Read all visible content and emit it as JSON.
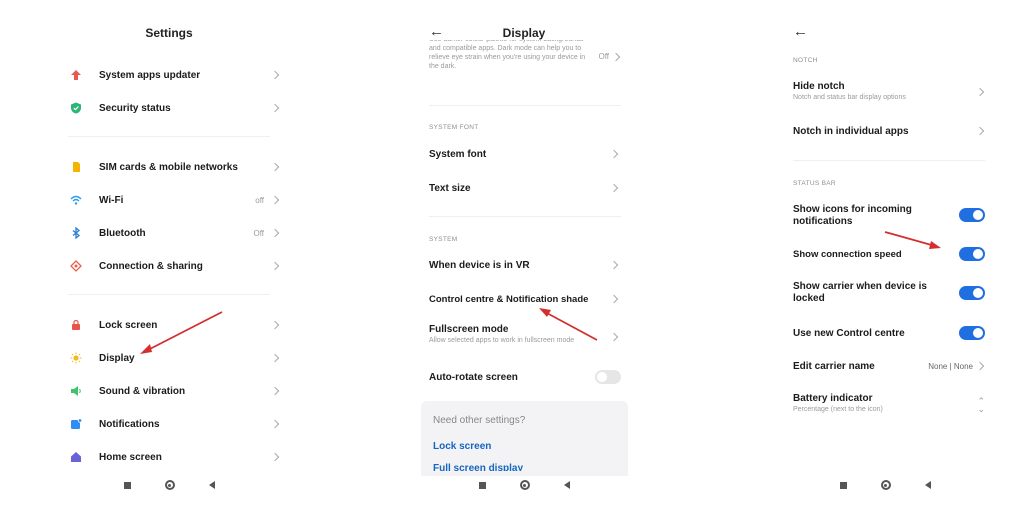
{
  "panel1": {
    "title": "Settings",
    "items": [
      {
        "label": "System apps updater",
        "icon": "arrow-up-icon",
        "value": ""
      },
      {
        "label": "Security status",
        "icon": "shield-icon",
        "value": ""
      },
      {
        "label": "SIM cards & mobile networks",
        "icon": "sim-card-icon",
        "value": ""
      },
      {
        "label": "Wi-Fi",
        "icon": "wifi-icon",
        "value": "off"
      },
      {
        "label": "Bluetooth",
        "icon": "bluetooth-icon",
        "value": "Off"
      },
      {
        "label": "Connection & sharing",
        "icon": "connection-sharing-icon",
        "value": ""
      },
      {
        "label": "Lock screen",
        "icon": "lock-icon",
        "value": ""
      },
      {
        "label": "Display",
        "icon": "sun-icon",
        "value": ""
      },
      {
        "label": "Sound & vibration",
        "icon": "speaker-icon",
        "value": ""
      },
      {
        "label": "Notifications",
        "icon": "notification-icon",
        "value": ""
      },
      {
        "label": "Home screen",
        "icon": "home-icon",
        "value": ""
      }
    ]
  },
  "panel2": {
    "title": "Display",
    "dark_mode_desc": "Use darker colour palette for system backgrounds and compatible apps. Dark mode can help you to relieve eye strain when you're using your device in the dark.",
    "dark_mode_value": "Off",
    "section_font": "SYSTEM FONT",
    "system_font": "System font",
    "text_size": "Text size",
    "section_system": "SYSTEM",
    "vr": "When device is in VR",
    "control_centre": "Control centre & Notification shade",
    "fullscreen": "Fullscreen mode",
    "fullscreen_sub": "Allow selected apps to work in fullscreen mode",
    "autorotate": "Auto-rotate screen",
    "card_title": "Need other settings?",
    "card_link1": "Lock screen",
    "card_link2": "Full screen display"
  },
  "panel3": {
    "section_notch": "NOTCH",
    "hide_notch": "Hide notch",
    "hide_notch_sub": "Notch and status bar display options",
    "notch_apps": "Notch in individual apps",
    "section_status": "STATUS BAR",
    "show_icons": "Show icons for incoming notifications",
    "show_speed": "Show connection speed",
    "show_carrier": "Show carrier when device is locked",
    "new_control": "Use new Control centre",
    "carrier_name": "Edit carrier name",
    "carrier_value": "None | None",
    "battery": "Battery indicator",
    "battery_sub": "Percentage (next to the icon)"
  },
  "colors": {
    "accent": "#1f6fe0",
    "arrow": "#d32f2f",
    "link": "#1565c0"
  }
}
